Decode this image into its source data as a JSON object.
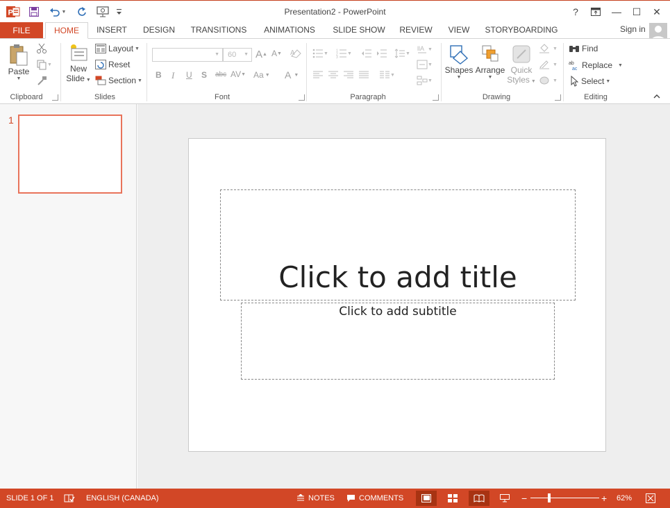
{
  "window": {
    "title": "Presentation2 - PowerPoint",
    "help": "?",
    "restore_ribbon": "⧉",
    "minimize": "—",
    "maximize": "☐",
    "close": "✕"
  },
  "tabs": {
    "file": "FILE",
    "items": [
      "HOME",
      "INSERT",
      "DESIGN",
      "TRANSITIONS",
      "ANIMATIONS",
      "SLIDE SHOW",
      "REVIEW",
      "VIEW",
      "STORYBOARDING"
    ],
    "active": "HOME",
    "signin": "Sign in"
  },
  "ribbon": {
    "clipboard": {
      "label": "Clipboard",
      "paste": "Paste"
    },
    "slides": {
      "label": "Slides",
      "new_slide_1": "New",
      "new_slide_2": "Slide",
      "layout": "Layout",
      "reset": "Reset",
      "section": "Section"
    },
    "font": {
      "label": "Font",
      "font_name": "",
      "font_size": "60",
      "bold": "B",
      "italic": "I",
      "underline": "U",
      "shadow": "S",
      "strike": "abc",
      "spacing": "AV",
      "case": "Aa",
      "grow": "A",
      "shrink": "A",
      "color": "A"
    },
    "paragraph": {
      "label": "Paragraph"
    },
    "drawing": {
      "label": "Drawing",
      "shapes": "Shapes",
      "arrange": "Arrange",
      "quick_styles_1": "Quick",
      "quick_styles_2": "Styles"
    },
    "editing": {
      "label": "Editing",
      "find": "Find",
      "replace": "Replace",
      "select": "Select"
    }
  },
  "thumbnails": [
    {
      "number": "1"
    }
  ],
  "slide": {
    "title_placeholder": "Click to add title",
    "subtitle_placeholder": "Click to add subtitle"
  },
  "statusbar": {
    "slide_info": "SLIDE 1 OF 1",
    "language": "ENGLISH (CANADA)",
    "notes": "NOTES",
    "comments": "COMMENTS",
    "zoom": "62%",
    "zoom_minus": "−",
    "zoom_plus": "+"
  },
  "colors": {
    "accent": "#d24726",
    "thumb_border": "#e8735a"
  }
}
